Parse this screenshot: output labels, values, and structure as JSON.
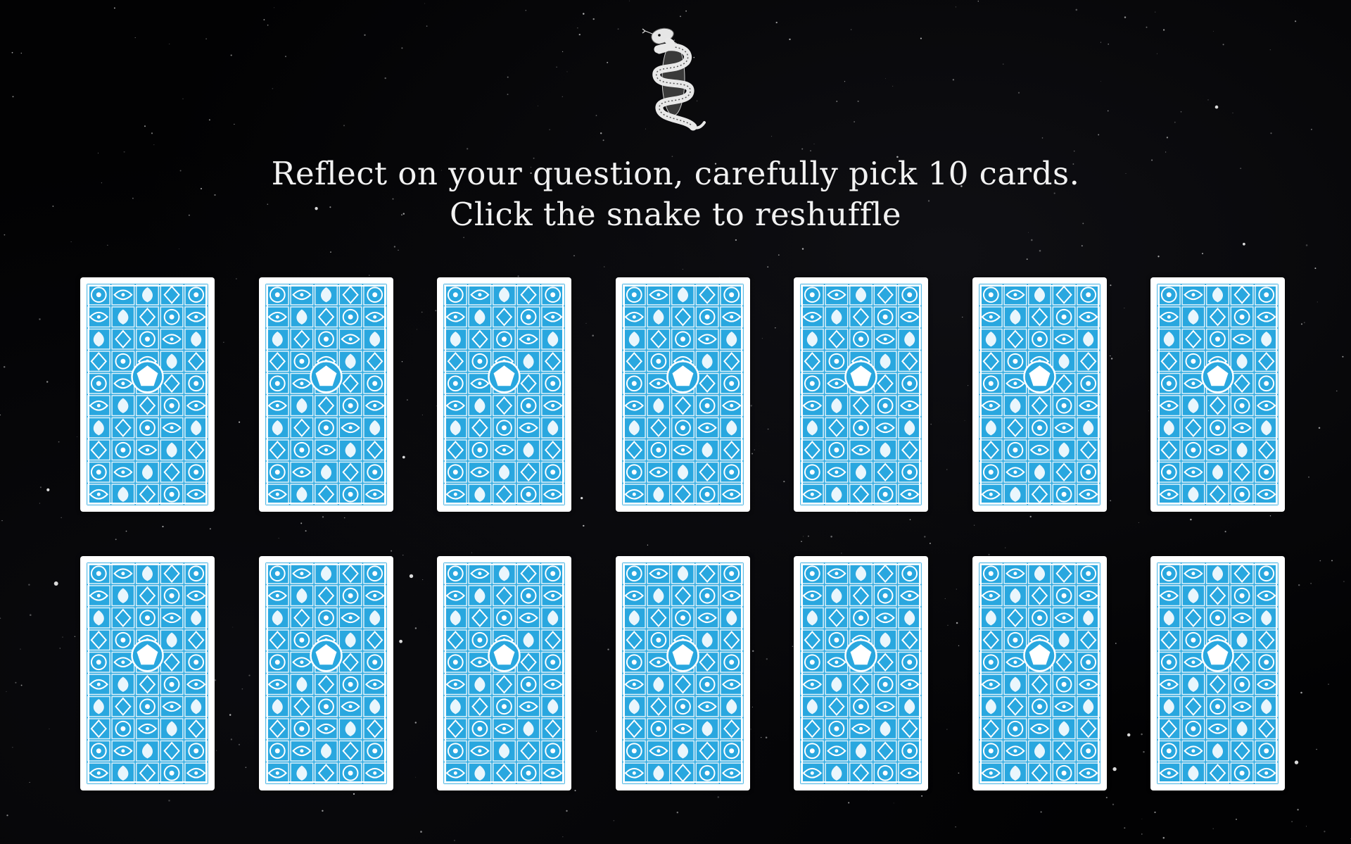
{
  "instructions": {
    "line1": "Reflect on your question, carefully pick 10 cards.",
    "line2": "Click the snake to reshuffle"
  },
  "snake": {
    "icon": "snake-icon"
  },
  "theme": {
    "background": "#020203",
    "card_blue": "#29a7df",
    "card_border": "#ffffff",
    "text": "#f2f2f2"
  },
  "deck": {
    "card_count": 14,
    "columns": 7,
    "rows": 2,
    "pick_count": 10
  }
}
